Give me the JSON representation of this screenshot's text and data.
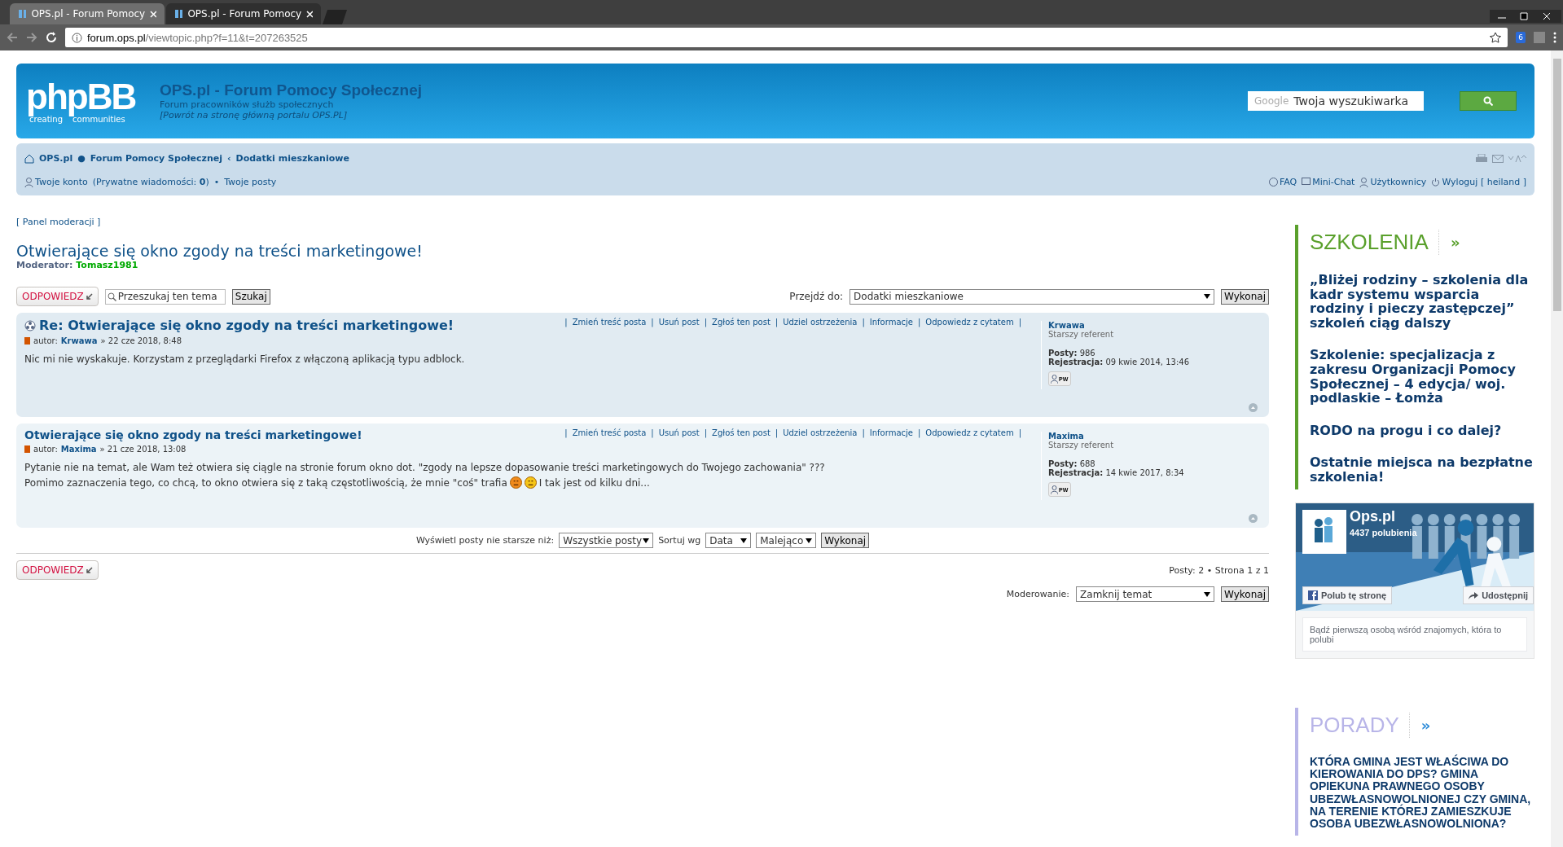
{
  "browser": {
    "tabs": [
      {
        "title": "OPS.pl - Forum Pomocy",
        "selected": true
      },
      {
        "title": "OPS.pl - Forum Pomocy",
        "selected": false
      }
    ],
    "url": {
      "host": "forum.ops.pl",
      "path": "/viewtopic.php?f=11&t=207263525"
    },
    "extension_badge": "6"
  },
  "header": {
    "logo": "phpBB",
    "logo_tagline": [
      "creating",
      "communities"
    ],
    "site_title": "OPS.pl - Forum Pomocy Społecznej",
    "description": "Forum pracowników służb społecznych",
    "back_link": "[Powrót na stronę główną portalu OPS.PL]",
    "search": {
      "brand": "Google",
      "placeholder": "Twoja wyszukiwarka"
    }
  },
  "breadcrumbs": [
    {
      "label": "OPS.pl",
      "separator": "●"
    },
    {
      "label": "Forum Pomocy Społecznej",
      "separator": "‹"
    },
    {
      "label": "Dodatki mieszkaniowe"
    }
  ],
  "userbar": {
    "account": "Twoje konto",
    "messages": "(Prywatne wiadomości: **0**)",
    "dot": "•",
    "posts": "Twoje posty",
    "links": [
      {
        "kind": "faq",
        "label": "FAQ"
      },
      {
        "kind": "chat",
        "label": "Mini-Chat"
      },
      {
        "kind": "users",
        "label": "Użytkownicy"
      },
      {
        "kind": "logout",
        "label": "Wyloguj [ heiland ]"
      }
    ]
  },
  "mod_panel": "[ Panel moderacji ]",
  "topic": {
    "title": "Otwierające się okno zgody na treści marketingowe!",
    "moderator_label": "Moderator:",
    "moderator": "Tomasz1981"
  },
  "toolbar": {
    "reply": "ODPOWIEDZ",
    "search_value": "Przeszukaj ten tema",
    "search_button": "Szukaj",
    "jump_label": "Przejdź do:",
    "jump_value": "Dodatki mieszkaniowe",
    "jump_button": "Wykonaj"
  },
  "action_separator": "|",
  "posts": [
    {
      "unread": true,
      "title": "Re: Otwierające się okno zgody na treści marketingowe!",
      "author_label": "autor:",
      "author": "Krwawa",
      "date": "» 22 cze 2018, 8:48",
      "actions": [
        "Zmień treść posta",
        "Usuń post",
        "Zgłoś ten post",
        "Udziel ostrzeżenia",
        "Informacje",
        "Odpowiedz z cytatem"
      ],
      "body": [
        [
          {
            "kind": "text",
            "text": "Nic mi nie wyskakuje. Korzystam z przeglądarki Firefox z włączoną aplikacją typu adblock."
          }
        ]
      ],
      "profile": {
        "name": "Krwawa",
        "rank": "Starszy referent",
        "posts_label": "Posty:",
        "posts": "986",
        "reg_label": "Rejestracja:",
        "reg": "09 kwie 2014, 13:46",
        "pm": "PW"
      }
    },
    {
      "unread": false,
      "title": "Otwierające się okno zgody na treści marketingowe!",
      "author_label": "autor:",
      "author": "Maxima",
      "date": "» 21 cze 2018, 13:08",
      "actions": [
        "Zmień treść posta",
        "Usuń post",
        "Zgłoś ten post",
        "Udziel ostrzeżenia",
        "Informacje",
        "Odpowiedz z cytatem"
      ],
      "body": [
        [
          {
            "kind": "text",
            "text": "Pytanie nie na temat, ale Wam też otwiera się ciągle na stronie forum okno dot. \"zgody na lepsze dopasowanie treści marketingowych do Twojego zachowania\" ???"
          }
        ],
        [
          {
            "kind": "text",
            "text": "Pomimo zaznaczenia tego, co chcą, to okno otwiera się z taką częstotliwością, że mnie \"coś\" trafia"
          },
          {
            "kind": "emoticon",
            "color": "#f08a1c"
          },
          {
            "kind": "emoticon",
            "color": "#f5c518"
          },
          {
            "kind": "text",
            "text": "I tak jest od kilku dni..."
          }
        ]
      ],
      "profile": {
        "name": "Maxima",
        "rank": "Starszy referent",
        "posts_label": "Posty:",
        "posts": "688",
        "reg_label": "Rejestracja:",
        "reg": "14 kwie 2017, 8:34",
        "pm": "PW"
      }
    }
  ],
  "sort": {
    "age_label": "Wyświetl posty nie starsze niż:",
    "age": "Wszystkie posty",
    "sort_label": "Sortuj wg",
    "field": "Data",
    "order": "Malejąco",
    "button": "Wykonaj"
  },
  "footer": {
    "reply": "ODPOWIEDZ",
    "pagination": "Posty: 2 • Strona 1 z 1",
    "mod_label": "Moderowanie:",
    "mod_action": "Zamknij temat",
    "mod_button": "Wykonaj"
  },
  "sidebar": {
    "sections": [
      {
        "title": "SZKOLENIA",
        "more": "»",
        "color": "#5aa02c",
        "caps": false,
        "items": [
          "„Bliżej rodziny – szkolenia dla kadr systemu wsparcia rodziny i pieczy zastępczej” szkoleń ciąg dalszy",
          "Szkolenie: specjalizacja z zakresu Organizacji Pomocy Społecznej – 4 edycja/ woj. podlaskie – Łomża",
          "RODO na progu i co dalej?",
          "Ostatnie miejsca na bezpłatne szkolenia!"
        ]
      },
      {
        "title": "PORADY",
        "more": "»",
        "color": "#b8b5e8",
        "caps": true,
        "items": [
          "KTÓRA GMINA JEST WŁAŚCIWA DO KIEROWANIA DO DPS? GMINA OPIEKUNA PRAWNEGO OSOBY UBEZWŁASNOWOLNIONEJ CZY GMINA, NA TERENIE KTÓREJ ZAMIESZKUJE OSOBA UBEZWŁASNOWOLNIONA?"
        ]
      }
    ],
    "facebook": {
      "page": "Ops.pl",
      "likes": "4437 polubienia",
      "like": "Polub tę stronę",
      "share": "Udostępnij",
      "note": "Bądź pierwszą osobą wśród znajomych, która to polubi"
    }
  }
}
